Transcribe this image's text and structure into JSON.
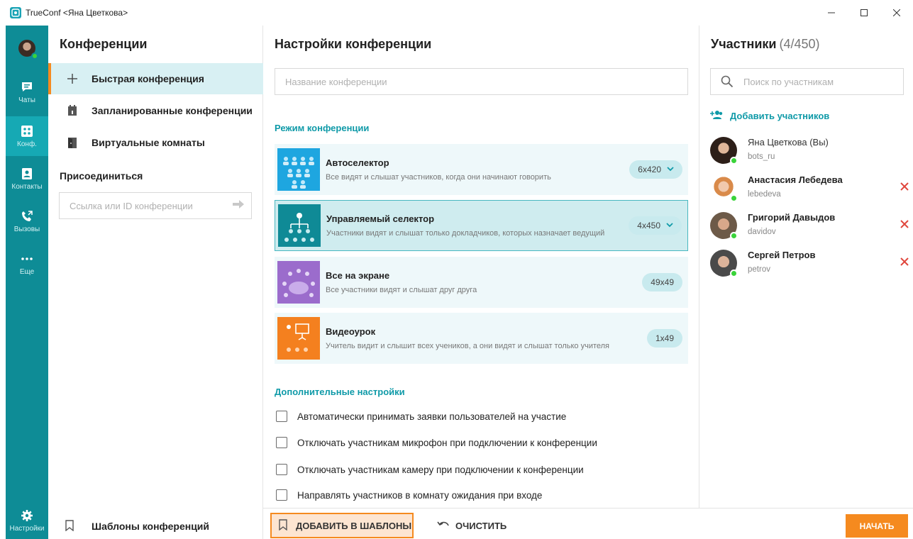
{
  "window": {
    "title": "TrueConf <Яна Цветкова>",
    "app_icon": "trueconf-logo-icon"
  },
  "rail": {
    "items": [
      {
        "label": "Чаты",
        "icon": "chat-icon"
      },
      {
        "label": "Конф.",
        "icon": "conference-icon"
      },
      {
        "label": "Контакты",
        "icon": "contacts-icon"
      },
      {
        "label": "Вызовы",
        "icon": "calls-icon"
      },
      {
        "label": "Еще",
        "icon": "more-icon"
      }
    ],
    "settings_label": "Настройки",
    "active": "Конф."
  },
  "conferences": {
    "title": "Конференции",
    "menu": [
      {
        "label": "Быстрая конференция",
        "icon": "plus-icon"
      },
      {
        "label": "Запланированные конференции",
        "icon": "calendar-icon"
      },
      {
        "label": "Виртуальные комнаты",
        "icon": "door-icon"
      }
    ],
    "join_label": "Присоединиться",
    "join_placeholder": "Ссылка или ID конференции",
    "templates_label": "Шаблоны конференций"
  },
  "settings": {
    "title": "Настройки конференции",
    "name_placeholder": "Название конференции",
    "mode_section": "Режим конференции",
    "modes": [
      {
        "title": "Автоселектор",
        "desc": "Все видят и слышат участников, когда они начинают говорить",
        "size": "6x420",
        "has_dropdown": true
      },
      {
        "title": "Управляемый селектор",
        "desc": "Участники видят и слышат только докладчиков, которых назначает ведущий",
        "size": "4x450",
        "has_dropdown": true,
        "selected": true
      },
      {
        "title": "Все на экране",
        "desc": "Все участники видят и слышат друг друга",
        "size": "49x49",
        "has_dropdown": false
      },
      {
        "title": "Видеоурок",
        "desc": "Учитель видит и слышит всех учеников, а они видят и слышат только учителя",
        "size": "1x49",
        "has_dropdown": false
      }
    ],
    "extra_section": "Дополнительные настройки",
    "options": [
      "Автоматически принимать заявки пользователей на участие",
      "Отключать участникам микрофон при подключении к конференции",
      "Отключать участникам камеру при подключении к конференции",
      "Направлять участников в комнату ожидания при входе"
    ]
  },
  "bottom": {
    "add_templates": "ДОБАВИТЬ В ШАБЛОНЫ",
    "clear": "ОЧИСТИТЬ",
    "start": "НАЧАТЬ"
  },
  "participants": {
    "title": "Участники",
    "count": "(4/450)",
    "search_placeholder": "Поиск по участникам",
    "add_label": "Добавить участников",
    "list": [
      {
        "name": "Яна Цветкова (Вы)",
        "login": "bots_ru",
        "removable": false
      },
      {
        "name": "Анастасия Лебедева",
        "login": "lebedeva",
        "removable": true
      },
      {
        "name": "Григорий Давыдов",
        "login": "davidov",
        "removable": true
      },
      {
        "name": "Сергей Петров",
        "login": "petrov",
        "removable": true
      }
    ]
  },
  "colors": {
    "rail": "#0e8c96",
    "accent": "#0f9aa8",
    "orange": "#f58a1f",
    "online": "#3ad33a",
    "remove": "#e0473d"
  }
}
